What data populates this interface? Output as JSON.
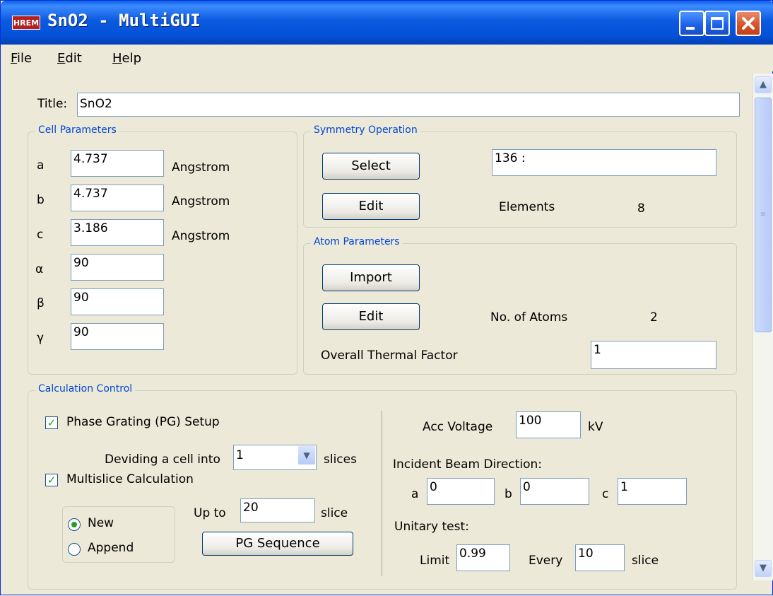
{
  "window": {
    "icon_text": "HREM",
    "title": "SnO2 - MultiGUI"
  },
  "menu": [
    {
      "label": "File"
    },
    {
      "label": "Edit"
    },
    {
      "label": "Help"
    }
  ],
  "title_field": {
    "label": "Title:",
    "value": "SnO2"
  },
  "cell": {
    "legend": "Cell Parameters",
    "a": {
      "label": "a",
      "value": "4.737",
      "unit": "Angstrom"
    },
    "b": {
      "label": "b",
      "value": "4.737",
      "unit": "Angstrom"
    },
    "c": {
      "label": "c",
      "value": "3.186",
      "unit": "Angstrom"
    },
    "alpha": {
      "label": "α",
      "value": "90"
    },
    "beta": {
      "label": "β",
      "value": "90"
    },
    "gamma": {
      "label": "γ",
      "value": "90"
    }
  },
  "symmetry": {
    "legend": "Symmetry Operation",
    "select_label": "Select",
    "edit_label": "Edit",
    "value": "136 :",
    "elements_label": "Elements",
    "elements_count": "8"
  },
  "atoms": {
    "legend": "Atom Parameters",
    "import_label": "Import",
    "edit_label": "Edit",
    "count_label": "No. of Atoms",
    "count": "2",
    "thermal_label": "Overall Thermal Factor",
    "thermal_value": "1"
  },
  "calc": {
    "legend": "Calculation Control",
    "pg_setup": {
      "label": "Phase Grating (PG) Setup",
      "checked": true
    },
    "dividing_label": "Deviding a cell into",
    "dividing_value": "1",
    "slices_label": "slices",
    "multislice": {
      "label": "Multislice Calculation",
      "checked": true
    },
    "new_label": "New",
    "append_label": "Append",
    "selected_mode": "New",
    "upto_label": "Up to",
    "upto_value": "20",
    "slice_label": "slice",
    "pg_sequence_label": "PG Sequence",
    "acc_voltage_label": "Acc Voltage",
    "acc_voltage_value": "100",
    "acc_voltage_unit": "kV",
    "beam_label": "Incident Beam Direction:",
    "beam": {
      "a_label": "a",
      "a_value": "0",
      "b_label": "b",
      "b_value": "0",
      "c_label": "c",
      "c_value": "1"
    },
    "unitary_label": "Unitary test:",
    "limit_label": "Limit",
    "limit_value": "0.99",
    "every_label": "Every",
    "every_value": "10",
    "every_unit": "slice"
  },
  "icons": {
    "minimize": "minimize-icon",
    "maximize": "maximize-icon",
    "close": "close-icon",
    "scroll_up": "chevron-up-icon",
    "scroll_down": "chevron-down-icon",
    "combo": "chevron-down-icon"
  },
  "colors": {
    "titlebar": "#0a5fe8",
    "background": "#ece9d8",
    "legend": "#0046d5",
    "close": "#d8542a",
    "check": "#21a121"
  }
}
